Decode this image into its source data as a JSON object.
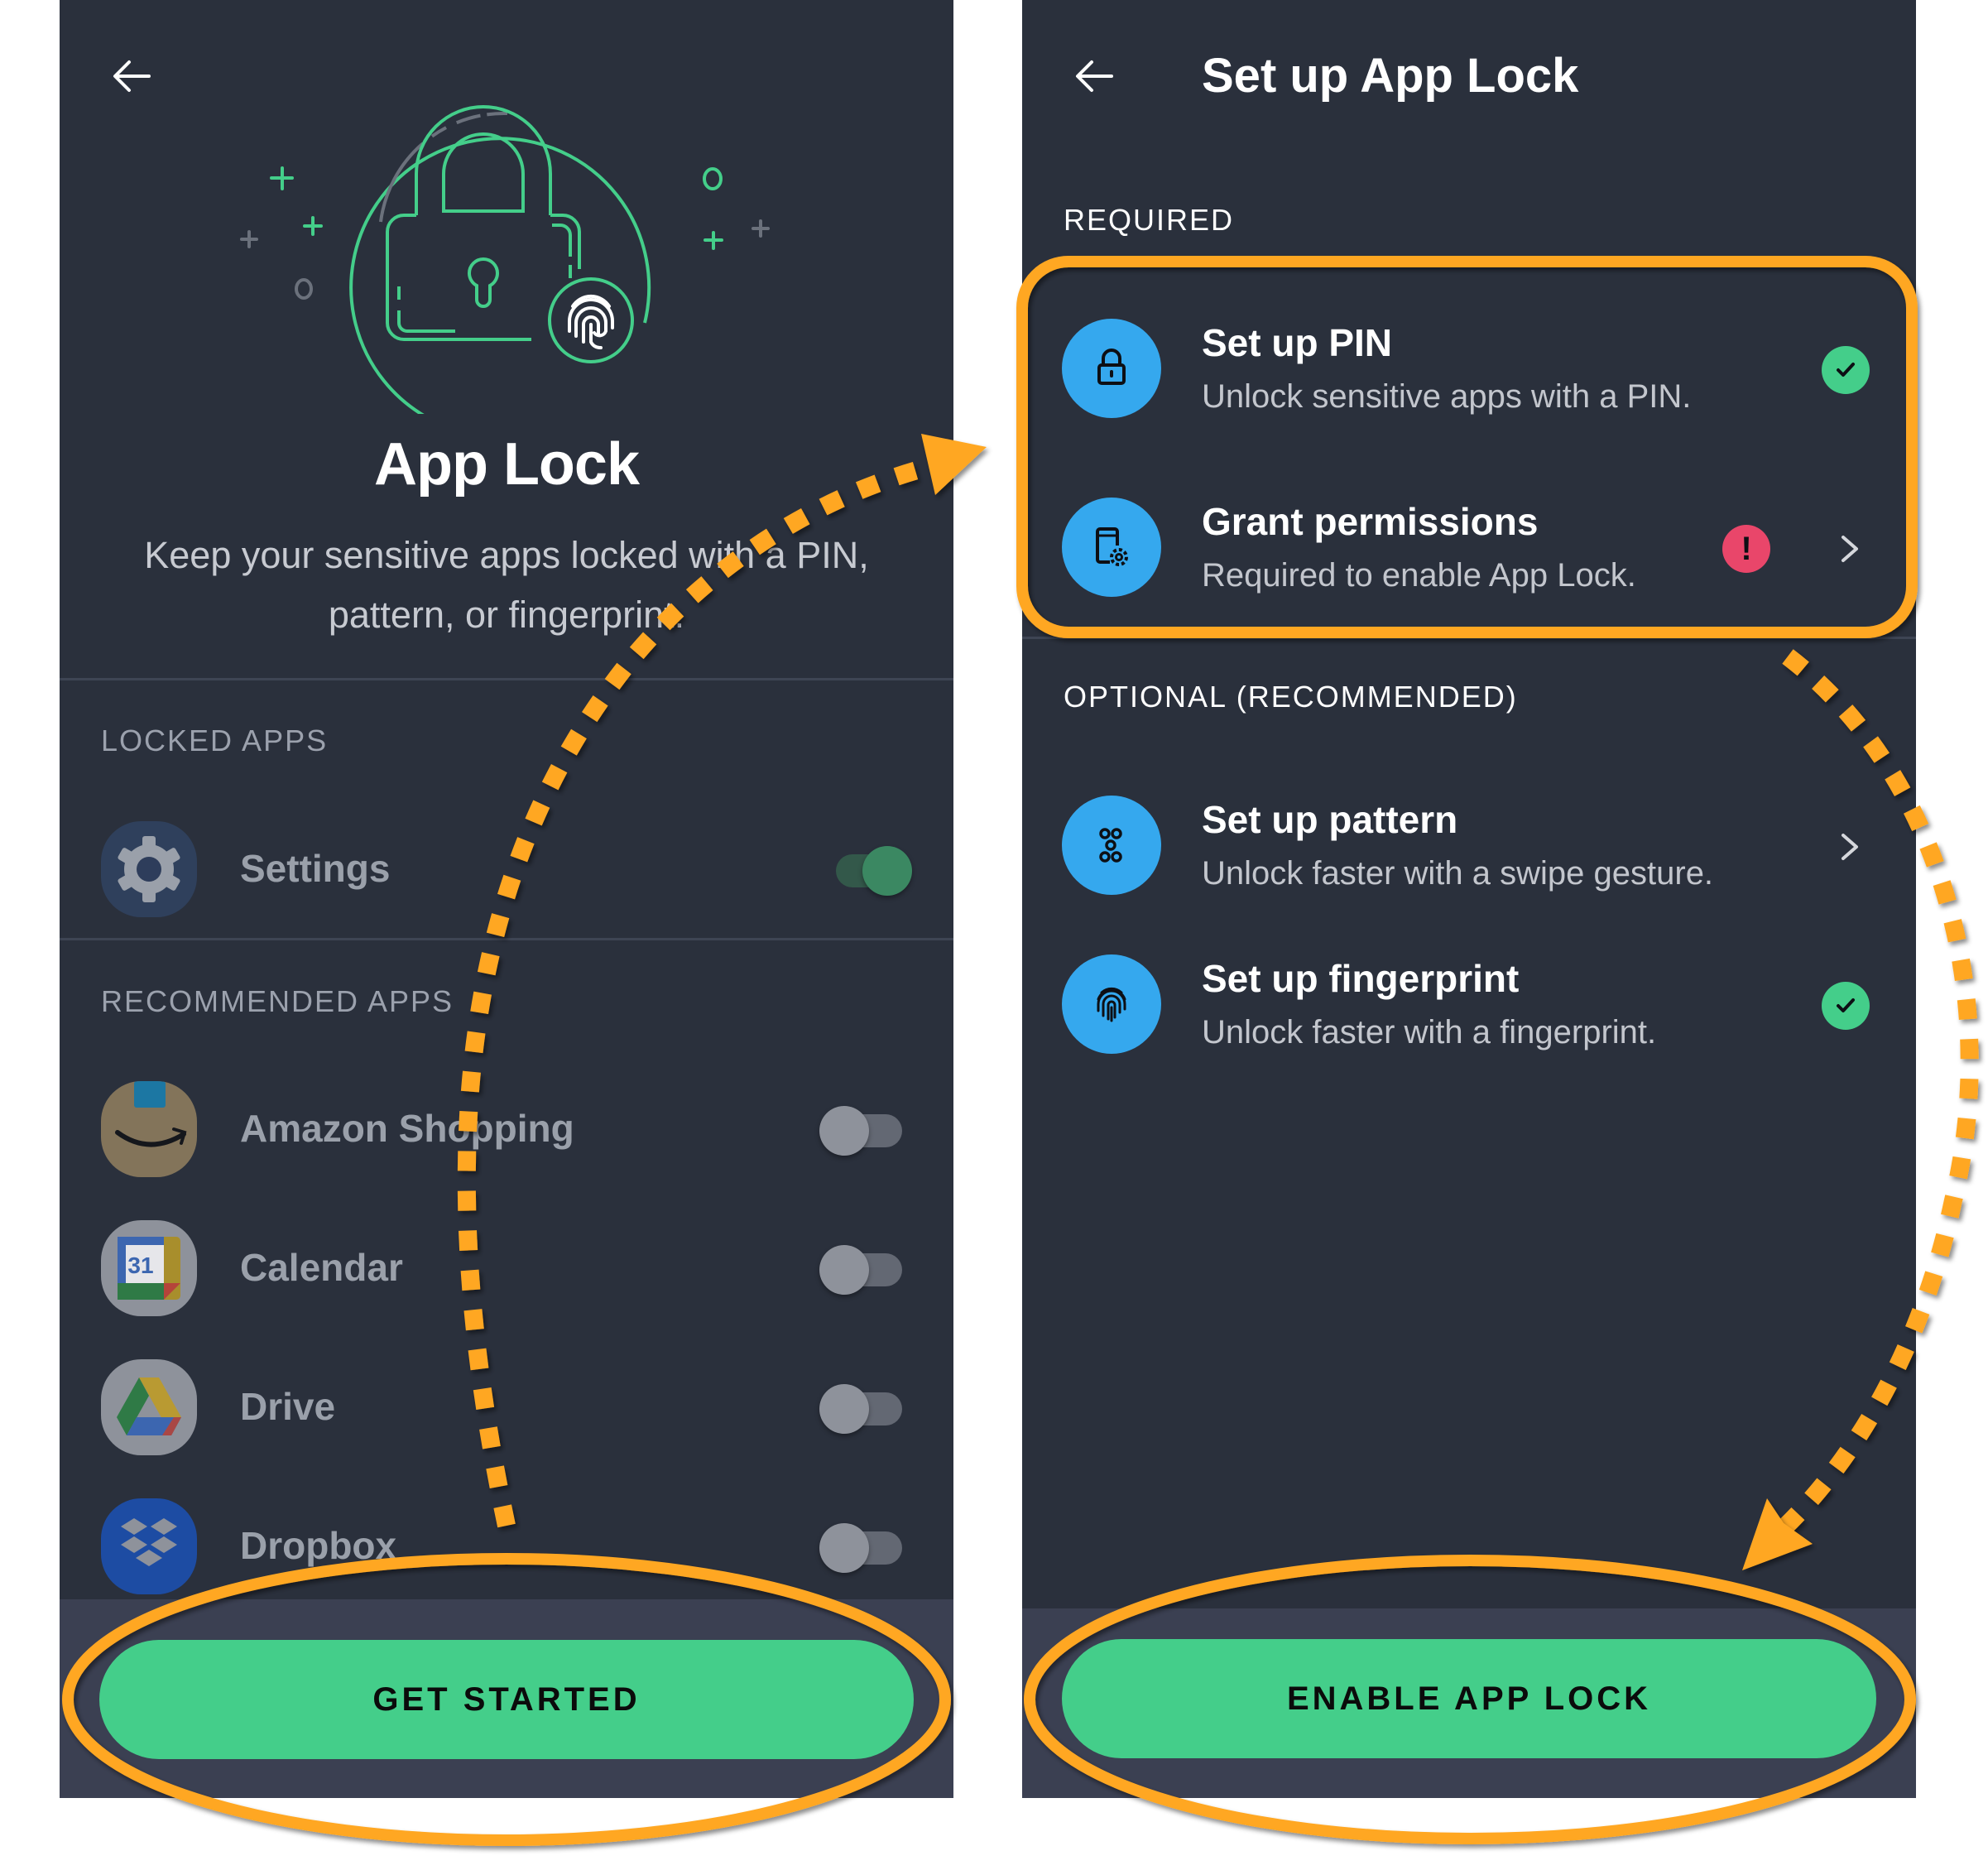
{
  "colors": {
    "background": "#2a303c",
    "footer": "#3b4052",
    "accent_green": "#44ce8a",
    "icon_blue": "#35a8ee",
    "warning_red": "#e9466a",
    "annotation_orange": "#ffa722"
  },
  "left_screen": {
    "back_icon": "arrow-left-icon",
    "hero_icon": "padlock-fingerprint-illustration",
    "title": "App Lock",
    "subtitle": "Keep your sensitive apps locked with a PIN, pattern, or fingerprint.",
    "sections": {
      "locked": {
        "label": "LOCKED APPS",
        "apps": [
          {
            "name": "Settings",
            "icon": "settings-gear-icon",
            "locked": true
          }
        ]
      },
      "recommended": {
        "label": "RECOMMENDED APPS",
        "apps": [
          {
            "name": "Amazon Shopping",
            "icon": "amazon-icon",
            "locked": false
          },
          {
            "name": "Calendar",
            "icon": "calendar-icon",
            "icon_text": "31",
            "locked": false
          },
          {
            "name": "Drive",
            "icon": "drive-icon",
            "locked": false
          },
          {
            "name": "Dropbox",
            "icon": "dropbox-icon",
            "locked": false
          }
        ]
      }
    },
    "primary_button": "GET STARTED"
  },
  "right_screen": {
    "back_icon": "arrow-left-icon",
    "title": "Set up App Lock",
    "required_label": "REQUIRED",
    "required_steps": [
      {
        "title": "Set up PIN",
        "description": "Unlock sensitive apps with a PIN.",
        "icon": "padlock-icon",
        "status": "complete",
        "has_chevron": false
      },
      {
        "title": "Grant permissions",
        "description": "Required to enable App Lock.",
        "icon": "phone-settings-icon",
        "status": "warning",
        "has_chevron": true
      }
    ],
    "optional_label": "OPTIONAL (RECOMMENDED)",
    "optional_steps": [
      {
        "title": "Set up pattern",
        "description": "Unlock faster with a swipe gesture.",
        "icon": "pattern-dots-icon",
        "status": "none",
        "has_chevron": true
      },
      {
        "title": "Set up fingerprint",
        "description": "Unlock faster with a fingerprint.",
        "icon": "fingerprint-icon",
        "status": "complete",
        "has_chevron": false
      }
    ],
    "primary_button": "ENABLE APP LOCK",
    "status_glyphs": {
      "warning": "!"
    }
  }
}
